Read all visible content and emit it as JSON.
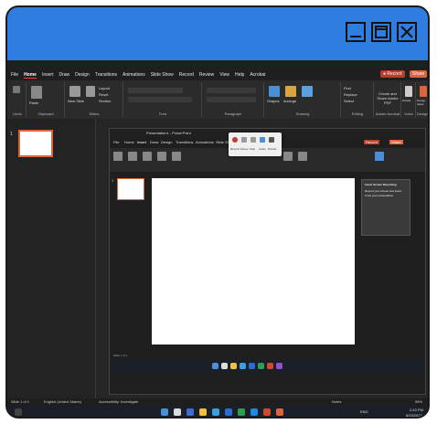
{
  "window_controls": {
    "minimize": "minimize",
    "maximize": "maximize",
    "close": "close"
  },
  "ribbon": {
    "tabs": [
      "File",
      "Home",
      "Insert",
      "Draw",
      "Design",
      "Transitions",
      "Animations",
      "Slide Show",
      "Record",
      "Review",
      "View",
      "Help",
      "Acrobat"
    ],
    "active_tab": "Home",
    "record_button": "● Record",
    "share_button": "Share",
    "groups": [
      "Undo",
      "Clipboard",
      "Slides",
      "Font",
      "Paragraph",
      "Drawing",
      "Editing",
      "Adobe Acrobat",
      "Voice",
      "Designer"
    ],
    "group_buttons": {
      "new_slide": "New Slide",
      "reuse_slides": "Reuse Slides",
      "layout": "Layout",
      "reset": "Reset",
      "section": "Section",
      "shapes": "Shapes",
      "arrange": "Arrange",
      "find": "Find",
      "replace": "Replace",
      "select": "Select",
      "create_share_pdf": "Create and Share Adobe PDF",
      "dictate": "Dictate",
      "design_ideas": "Design Ideas",
      "paste": "Paste"
    }
  },
  "sidebar": {
    "slide_number": "1"
  },
  "inner_window": {
    "title": "Presentation1 - PowerPoint",
    "tabs": [
      "File",
      "Home",
      "Insert",
      "Draw",
      "Design",
      "Transitions",
      "Animations",
      "Slide Show",
      "Record",
      "Review",
      "View",
      "Help",
      "Acrobat"
    ],
    "record_button": "Record",
    "share_button": "Share",
    "slide_number": "1",
    "recorder_items": [
      "Record",
      "Pause",
      "Stop",
      "Audio",
      "Pointer"
    ],
    "tooltip": {
      "title": "Insert Screen Recording",
      "line1": "Record your screen and insert",
      "line2": "it into your presentation."
    },
    "status_text": "Slide 1 of 1"
  },
  "status_bar": {
    "slide": "Slide 1 of 1",
    "language": "English (United States)",
    "accessibility": "Accessibility: Investigate",
    "notes": "Notes",
    "zoom": "58%"
  },
  "taskbar": {
    "time": "2:43 PM",
    "date": "8/23/2022",
    "lang": "ENG"
  },
  "colors": {
    "titlebar": "#2f7de1",
    "accent": "#e0643a",
    "record": "#c0392b"
  }
}
